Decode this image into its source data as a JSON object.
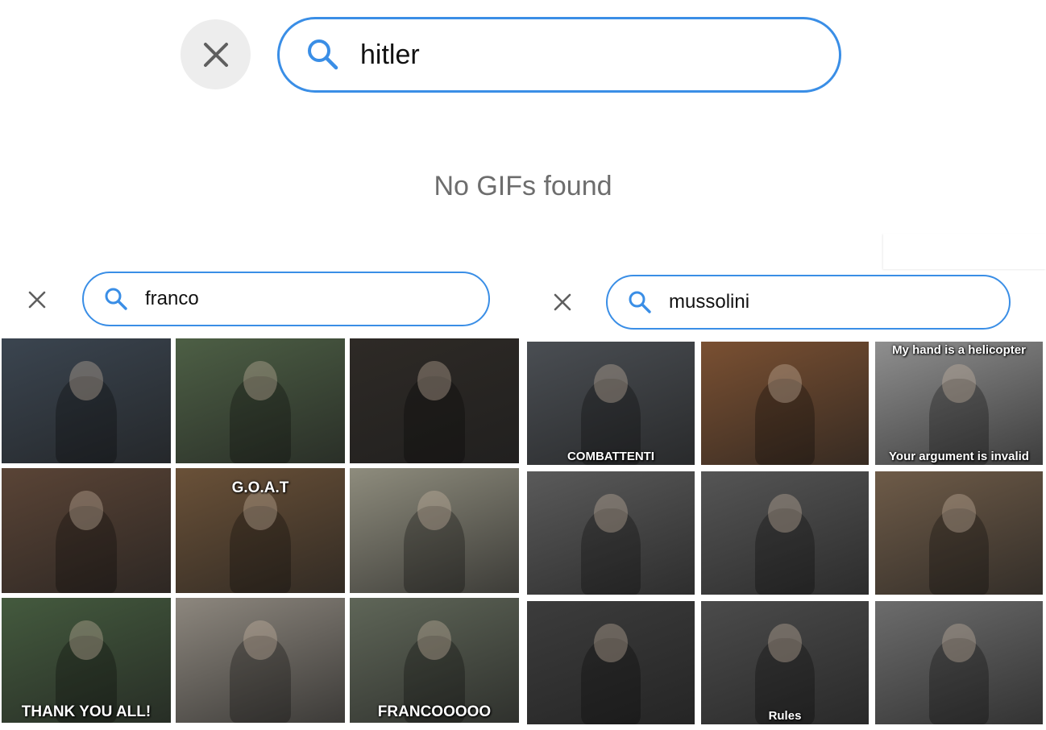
{
  "main_search": {
    "query": "hitler",
    "clear_label": "×"
  },
  "empty_message": "No GIFs found",
  "left_panel": {
    "query": "franco",
    "gifs": [
      {
        "caption": "",
        "pos": "",
        "bg": "#3b4550"
      },
      {
        "caption": "",
        "pos": "",
        "bg": "#4d5f45"
      },
      {
        "caption": "",
        "pos": "",
        "bg": "#2e2a26"
      },
      {
        "caption": "",
        "pos": "",
        "bg": "#5a4436"
      },
      {
        "caption": "G.O.A.T",
        "pos": "mid",
        "bg": "#6a5138"
      },
      {
        "caption": "",
        "pos": "",
        "bg": "#8e8c7d"
      },
      {
        "caption": "THANK YOU ALL!",
        "pos": "bottom",
        "bg": "#445a3e"
      },
      {
        "caption": "",
        "pos": "",
        "bg": "#8d877e"
      },
      {
        "caption": "FRANCOOOOO",
        "pos": "bottom",
        "bg": "#5f6658"
      }
    ]
  },
  "right_panel": {
    "query": "mussolini",
    "gifs": [
      {
        "caption": "COMBATTENTI",
        "pos": "bottom",
        "bg": "#4a4e53"
      },
      {
        "caption": "",
        "pos": "",
        "bg": "#7a5032"
      },
      {
        "caption": "My hand is a helicopter",
        "caption2": "Your argument is invalid",
        "pos": "both",
        "bg": "#8f8f8f"
      },
      {
        "caption": "",
        "pos": "",
        "bg": "#5a5a5a"
      },
      {
        "caption": "",
        "pos": "",
        "bg": "#555555"
      },
      {
        "caption": "",
        "pos": "",
        "bg": "#6e5b48"
      },
      {
        "caption": "",
        "pos": "",
        "bg": "#3c3c3c"
      },
      {
        "caption": "Rules",
        "pos": "bottom",
        "bg": "#4b4b4b"
      },
      {
        "caption": "",
        "pos": "",
        "bg": "#6c6c6c"
      }
    ]
  },
  "colors": {
    "accent": "#3a8ee6",
    "close_bg": "#ededed"
  }
}
